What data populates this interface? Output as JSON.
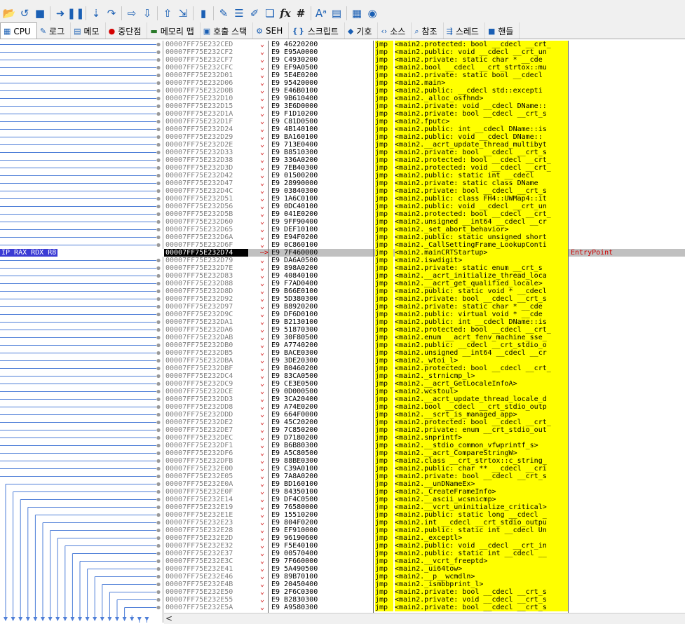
{
  "toolbar": {
    "buttons": [
      {
        "name": "open-icon",
        "glyph": "📂"
      },
      {
        "name": "restart-icon",
        "glyph": "↺"
      },
      {
        "name": "stop-icon",
        "glyph": "■"
      },
      {
        "name": "sep"
      },
      {
        "name": "run-icon",
        "glyph": "➜"
      },
      {
        "name": "pause-icon",
        "glyph": "❚❚"
      },
      {
        "name": "sep"
      },
      {
        "name": "step-into-icon",
        "glyph": "⇣"
      },
      {
        "name": "step-over-icon",
        "glyph": "↷"
      },
      {
        "name": "sep"
      },
      {
        "name": "trace-into-icon",
        "glyph": "⇨"
      },
      {
        "name": "trace-over-icon",
        "glyph": "⇩"
      },
      {
        "name": "sep"
      },
      {
        "name": "execute-till-return-icon",
        "glyph": "⇧"
      },
      {
        "name": "run-to-user-code-icon",
        "glyph": "⇲"
      },
      {
        "name": "sep"
      },
      {
        "name": "scylla-icon",
        "glyph": "▮"
      },
      {
        "name": "sep"
      },
      {
        "name": "patch-icon",
        "glyph": "✎"
      },
      {
        "name": "comments-icon",
        "glyph": "☰"
      },
      {
        "name": "labels-icon",
        "glyph": "✐"
      },
      {
        "name": "bookmarks-icon",
        "glyph": "❏"
      },
      {
        "name": "functions-icon",
        "glyph": "fx"
      },
      {
        "name": "variables-icon",
        "glyph": "#"
      },
      {
        "name": "sep"
      },
      {
        "name": "font-icon",
        "glyph": "Aᵃ"
      },
      {
        "name": "document-icon",
        "glyph": "▤"
      },
      {
        "name": "sep"
      },
      {
        "name": "calculator-icon",
        "glyph": "▦"
      },
      {
        "name": "globe-icon",
        "glyph": "◉"
      }
    ]
  },
  "tabs": [
    {
      "label": "CPU",
      "icon": "cpu-icon",
      "glyph": "▦",
      "active": true
    },
    {
      "label": "로그",
      "icon": "log-icon",
      "glyph": "✎"
    },
    {
      "label": "메모",
      "icon": "notes-icon",
      "glyph": "▤"
    },
    {
      "label": "중단점",
      "icon": "breakpoints-icon",
      "glyph": "●",
      "color": "red"
    },
    {
      "label": "메모리 맵",
      "icon": "memory-map-icon",
      "glyph": "▬",
      "color": "green"
    },
    {
      "label": "호출 스택",
      "icon": "call-stack-icon",
      "glyph": "▣"
    },
    {
      "label": "SEH",
      "icon": "seh-icon",
      "glyph": "⚙"
    },
    {
      "label": "스크립트",
      "icon": "script-icon",
      "glyph": "❴❵"
    },
    {
      "label": "기호",
      "icon": "symbols-icon",
      "glyph": "◆"
    },
    {
      "label": "소스",
      "icon": "source-icon",
      "glyph": "‹›"
    },
    {
      "label": "참조",
      "icon": "references-icon",
      "glyph": "⌕"
    },
    {
      "label": "스레드",
      "icon": "threads-icon",
      "glyph": "⇶"
    },
    {
      "label": "핸들",
      "icon": "handles-icon",
      "glyph": "■"
    }
  ],
  "register_tag": "IP RAX RDX R8",
  "disassembly": [
    {
      "addr": "00007FF75E232CED",
      "hex": "E9 46220200",
      "mn": "jmp",
      "op": "<main2.protected: bool __cdecl __crt_"
    },
    {
      "addr": "00007FF75E232CF2",
      "hex": "E9 E95A0000",
      "mn": "jmp",
      "op": "<main2.public: void __cdecl __crt_un"
    },
    {
      "addr": "00007FF75E232CF7",
      "hex": "E9 C4930200",
      "mn": "jmp",
      "op": "<main2.private: static char * __cde"
    },
    {
      "addr": "00007FF75E232CFC",
      "hex": "E9 EF9A0500",
      "mn": "jmp",
      "op": "<main2.bool __cdecl __crt_strtox::mu"
    },
    {
      "addr": "00007FF75E232D01",
      "hex": "E9 5E4E0200",
      "mn": "jmp",
      "op": "<main2.private: static bool __cdecl "
    },
    {
      "addr": "00007FF75E232D06",
      "hex": "E9 95420000",
      "mn": "jmp",
      "op": "<main2.main>"
    },
    {
      "addr": "00007FF75E232D0B",
      "hex": "E9 E46B0100",
      "mn": "jmp",
      "op": "<main2.public: __cdecl std::excepti"
    },
    {
      "addr": "00007FF75E232D10",
      "hex": "E9 9B610400",
      "mn": "jmp",
      "op": "<main2._alloc_osfhnd>"
    },
    {
      "addr": "00007FF75E232D15",
      "hex": "E9 3E6D0000",
      "mn": "jmp",
      "op": "<main2.private: void __cdecl DName::"
    },
    {
      "addr": "00007FF75E232D1A",
      "hex": "E9 F1D10200",
      "mn": "jmp",
      "op": "<main2.private: bool __cdecl __crt_s"
    },
    {
      "addr": "00007FF75E232D1F",
      "hex": "E9 C81D0500",
      "mn": "jmp",
      "op": "<main2.fputc>"
    },
    {
      "addr": "00007FF75E232D24",
      "hex": "E9 4B140100",
      "mn": "jmp",
      "op": "<main2.public: int __cdecl DName::is"
    },
    {
      "addr": "00007FF75E232D29",
      "hex": "E9 BA160100",
      "mn": "jmp",
      "op": "<main2.public: void __cdecl DName::"
    },
    {
      "addr": "00007FF75E232D2E",
      "hex": "E9 713E0400",
      "mn": "jmp",
      "op": "<main2.__acrt_update_thread_multibyt"
    },
    {
      "addr": "00007FF75E232D33",
      "hex": "E9 B8510300",
      "mn": "jmp",
      "op": "<main2.private: bool __cdecl __crt_s"
    },
    {
      "addr": "00007FF75E232D38",
      "hex": "E9 336A0200",
      "mn": "jmp",
      "op": "<main2.protected: bool __cdecl __crt_"
    },
    {
      "addr": "00007FF75E232D3D",
      "hex": "E9 7EB40300",
      "mn": "jmp",
      "op": "<main2.protected: void __cdecl __crt_"
    },
    {
      "addr": "00007FF75E232D42",
      "hex": "E9 01500200",
      "mn": "jmp",
      "op": "<main2.public: static int __cdecl "
    },
    {
      "addr": "00007FF75E232D47",
      "hex": "E9 28990000",
      "mn": "jmp",
      "op": "<main2.private: static class DName "
    },
    {
      "addr": "00007FF75E232D4C",
      "hex": "E9 03840300",
      "mn": "jmp",
      "op": "<main2.private: bool __cdecl __crt_s"
    },
    {
      "addr": "00007FF75E232D51",
      "hex": "E9 1A6C0100",
      "mn": "jmp",
      "op": "<main2.public: class FH4::UWMap4::it"
    },
    {
      "addr": "00007FF75E232D56",
      "hex": "E9 0DC40100",
      "mn": "jmp",
      "op": "<main2.public: void __cdecl __crt_un"
    },
    {
      "addr": "00007FF75E232D5B",
      "hex": "E9 041E0200",
      "mn": "jmp",
      "op": "<main2.protected: bool __cdecl __crt_"
    },
    {
      "addr": "00007FF75E232D60",
      "hex": "E9 9FF90400",
      "mn": "jmp",
      "op": "<main2.unsigned __int64 __cdecl __cr"
    },
    {
      "addr": "00007FF75E232D65",
      "hex": "E9 DEF10100",
      "mn": "jmp",
      "op": "<main2._set_abort_behavior>"
    },
    {
      "addr": "00007FF75E232D6A",
      "hex": "E9 E94F0200",
      "mn": "jmp",
      "op": "<main2.public: static unsigned short"
    },
    {
      "addr": "00007FF75E232D6F",
      "hex": "E9 0C860100",
      "mn": "jmp",
      "op": "<main2._CallSettingFrame_LookupConti"
    },
    {
      "addr": "00007FF75E232D74",
      "hex": "E9 7F460000",
      "mn": "jmp",
      "op": "<main2.mainCRTStartup>",
      "comment": "EntryPoint",
      "selected": true
    },
    {
      "addr": "00007FF75E232D79",
      "hex": "E9 DA6A0500",
      "mn": "jmp",
      "op": "<main2.iswdigit>"
    },
    {
      "addr": "00007FF75E232D7E",
      "hex": "E9 898A0200",
      "mn": "jmp",
      "op": "<main2.private: static enum __crt_s"
    },
    {
      "addr": "00007FF75E232D83",
      "hex": "E9 40840100",
      "mn": "jmp",
      "op": "<main2.__acrt_initialize_thread_loca"
    },
    {
      "addr": "00007FF75E232D88",
      "hex": "E9 F7AD0400",
      "mn": "jmp",
      "op": "<main2.__acrt_get_qualified_locale>"
    },
    {
      "addr": "00007FF75E232D8D",
      "hex": "E9 B66E0100",
      "mn": "jmp",
      "op": "<main2.public: static void * __cdecl"
    },
    {
      "addr": "00007FF75E232D92",
      "hex": "E9 5D380300",
      "mn": "jmp",
      "op": "<main2.private: bool __cdecl __crt_s"
    },
    {
      "addr": "00007FF75E232D97",
      "hex": "E9 B8920200",
      "mn": "jmp",
      "op": "<main2.private: static char * __cde"
    },
    {
      "addr": "00007FF75E232D9C",
      "hex": "E9 DF6D0100",
      "mn": "jmp",
      "op": "<main2.public: virtual void * __cde"
    },
    {
      "addr": "00007FF75E232DA1",
      "hex": "E9 B2130100",
      "mn": "jmp",
      "op": "<main2.public: int __cdecl DName::is"
    },
    {
      "addr": "00007FF75E232DA6",
      "hex": "E9 51870300",
      "mn": "jmp",
      "op": "<main2.protected: bool __cdecl __crt_"
    },
    {
      "addr": "00007FF75E232DAB",
      "hex": "E9 30F80500",
      "mn": "jmp",
      "op": "<main2.enum __acrt_fenv_machine_sse_"
    },
    {
      "addr": "00007FF75E232DB0",
      "hex": "E9 A7740200",
      "mn": "jmp",
      "op": "<main2.public: __cdecl __crt_stdio_o"
    },
    {
      "addr": "00007FF75E232DB5",
      "hex": "E9 BACE0300",
      "mn": "jmp",
      "op": "<main2.unsigned __int64 __cdecl __cr"
    },
    {
      "addr": "00007FF75E232DBA",
      "hex": "E9 3DE20300",
      "mn": "jmp",
      "op": "<main2._wtoi_l>"
    },
    {
      "addr": "00007FF75E232DBF",
      "hex": "E9 B0460200",
      "mn": "jmp",
      "op": "<main2.protected: bool __cdecl __crt_"
    },
    {
      "addr": "00007FF75E232DC4",
      "hex": "E9 83CA0500",
      "mn": "jmp",
      "op": "<main2._strnicmp_l>"
    },
    {
      "addr": "00007FF75E232DC9",
      "hex": "E9 CE3E0500",
      "mn": "jmp",
      "op": "<main2.__acrt_GetLocaleInfoA>"
    },
    {
      "addr": "00007FF75E232DCE",
      "hex": "E9 0D000500",
      "mn": "jmp",
      "op": "<main2.wcstoul>"
    },
    {
      "addr": "00007FF75E232DD3",
      "hex": "E9 3CA20400",
      "mn": "jmp",
      "op": "<main2.__acrt_update_thread_locale_d"
    },
    {
      "addr": "00007FF75E232DD8",
      "hex": "E9 A74E0200",
      "mn": "jmp",
      "op": "<main2.bool __cdecl __crt_stdio_outp"
    },
    {
      "addr": "00007FF75E232DDD",
      "hex": "E9 664F0000",
      "mn": "jmp",
      "op": "<main2.__scrt_is_managed_app>"
    },
    {
      "addr": "00007FF75E232DE2",
      "hex": "E9 45C20200",
      "mn": "jmp",
      "op": "<main2.protected: bool __cdecl __crt_"
    },
    {
      "addr": "00007FF75E232DE7",
      "hex": "E9 7C850200",
      "mn": "jmp",
      "op": "<main2.private: enum __crt_stdio_out"
    },
    {
      "addr": "00007FF75E232DEC",
      "hex": "E9 D7180200",
      "mn": "jmp",
      "op": "<main2.snprintf>"
    },
    {
      "addr": "00007FF75E232DF1",
      "hex": "E9 B6B80300",
      "mn": "jmp",
      "op": "<main2.__stdio_common_vfwprintf_s>"
    },
    {
      "addr": "00007FF75E232DF6",
      "hex": "E9 A5C80500",
      "mn": "jmp",
      "op": "<main2.__acrt_CompareStringW>"
    },
    {
      "addr": "00007FF75E232DFB",
      "hex": "E9 88BE0300",
      "mn": "jmp",
      "op": "<main2.class __crt_strtox::c_string_"
    },
    {
      "addr": "00007FF75E232E00",
      "hex": "E9 C39A0100",
      "mn": "jmp",
      "op": "<main2.public: char ** __cdecl __cri"
    },
    {
      "addr": "00007FF75E232E05",
      "hex": "E9 7A8A0200",
      "mn": "jmp",
      "op": "<main2.private: bool __cdecl __crt_s"
    },
    {
      "addr": "00007FF75E232E0A",
      "hex": "E9 BD160100",
      "mn": "jmp",
      "op": "<main2.__unDNameEx>"
    },
    {
      "addr": "00007FF75E232E0F",
      "hex": "E9 84350100",
      "mn": "jmp",
      "op": "<main2._CreateFrameInfo>"
    },
    {
      "addr": "00007FF75E232E14",
      "hex": "E9 DF4C0500",
      "mn": "jmp",
      "op": "<main2.__ascii_wcsnicmp>"
    },
    {
      "addr": "00007FF75E232E19",
      "hex": "E9 76580000",
      "mn": "jmp",
      "op": "<main2.__vcrt_uninitialize_critical>"
    },
    {
      "addr": "00007FF75E232E1E",
      "hex": "E9 15510200",
      "mn": "jmp",
      "op": "<main2.public: static long __cdecl _"
    },
    {
      "addr": "00007FF75E232E23",
      "hex": "E9 804F0200",
      "mn": "jmp",
      "op": "<main2.int __cdecl __crt_stdio_outpu"
    },
    {
      "addr": "00007FF75E232E28",
      "hex": "E9 EF910000",
      "mn": "jmp",
      "op": "<main2.public: static int __cdecl Un"
    },
    {
      "addr": "00007FF75E232E2D",
      "hex": "E9 96190600",
      "mn": "jmp",
      "op": "<main2._exceptl>"
    },
    {
      "addr": "00007FF75E232E32",
      "hex": "E9 F5E40100",
      "mn": "jmp",
      "op": "<main2.public: void __cdecl __crt_in"
    },
    {
      "addr": "00007FF75E232E37",
      "hex": "E9 00570400",
      "mn": "jmp",
      "op": "<main2.public: static int __cdecl __"
    },
    {
      "addr": "00007FF75E232E3C",
      "hex": "E9 7F660000",
      "mn": "jmp",
      "op": "<main2.__vcrt_freeptd>"
    },
    {
      "addr": "00007FF75E232E41",
      "hex": "E9 5A490500",
      "mn": "jmp",
      "op": "<main2._ui64tow>"
    },
    {
      "addr": "00007FF75E232E46",
      "hex": "E9 89B70100",
      "mn": "jmp",
      "op": "<main2.__p__wcmdln>"
    },
    {
      "addr": "00007FF75E232E4B",
      "hex": "E9 20450400",
      "mn": "jmp",
      "op": "<main2._ismbbprint_l>"
    },
    {
      "addr": "00007FF75E232E50",
      "hex": "E9 2F6C0300",
      "mn": "jmp",
      "op": "<main2.private: bool __cdecl __crt_s"
    },
    {
      "addr": "00007FF75E232E55",
      "hex": "E9 B2830300",
      "mn": "jmp",
      "op": "<main2.private: void __cdecl __crt_s"
    },
    {
      "addr": "00007FF75E232E5A",
      "hex": "E9 A9580300",
      "mn": "jmp",
      "op": "<main2.private: bool __cdecl __crt_s"
    }
  ],
  "hscroll": {
    "left_arrow": "<"
  }
}
